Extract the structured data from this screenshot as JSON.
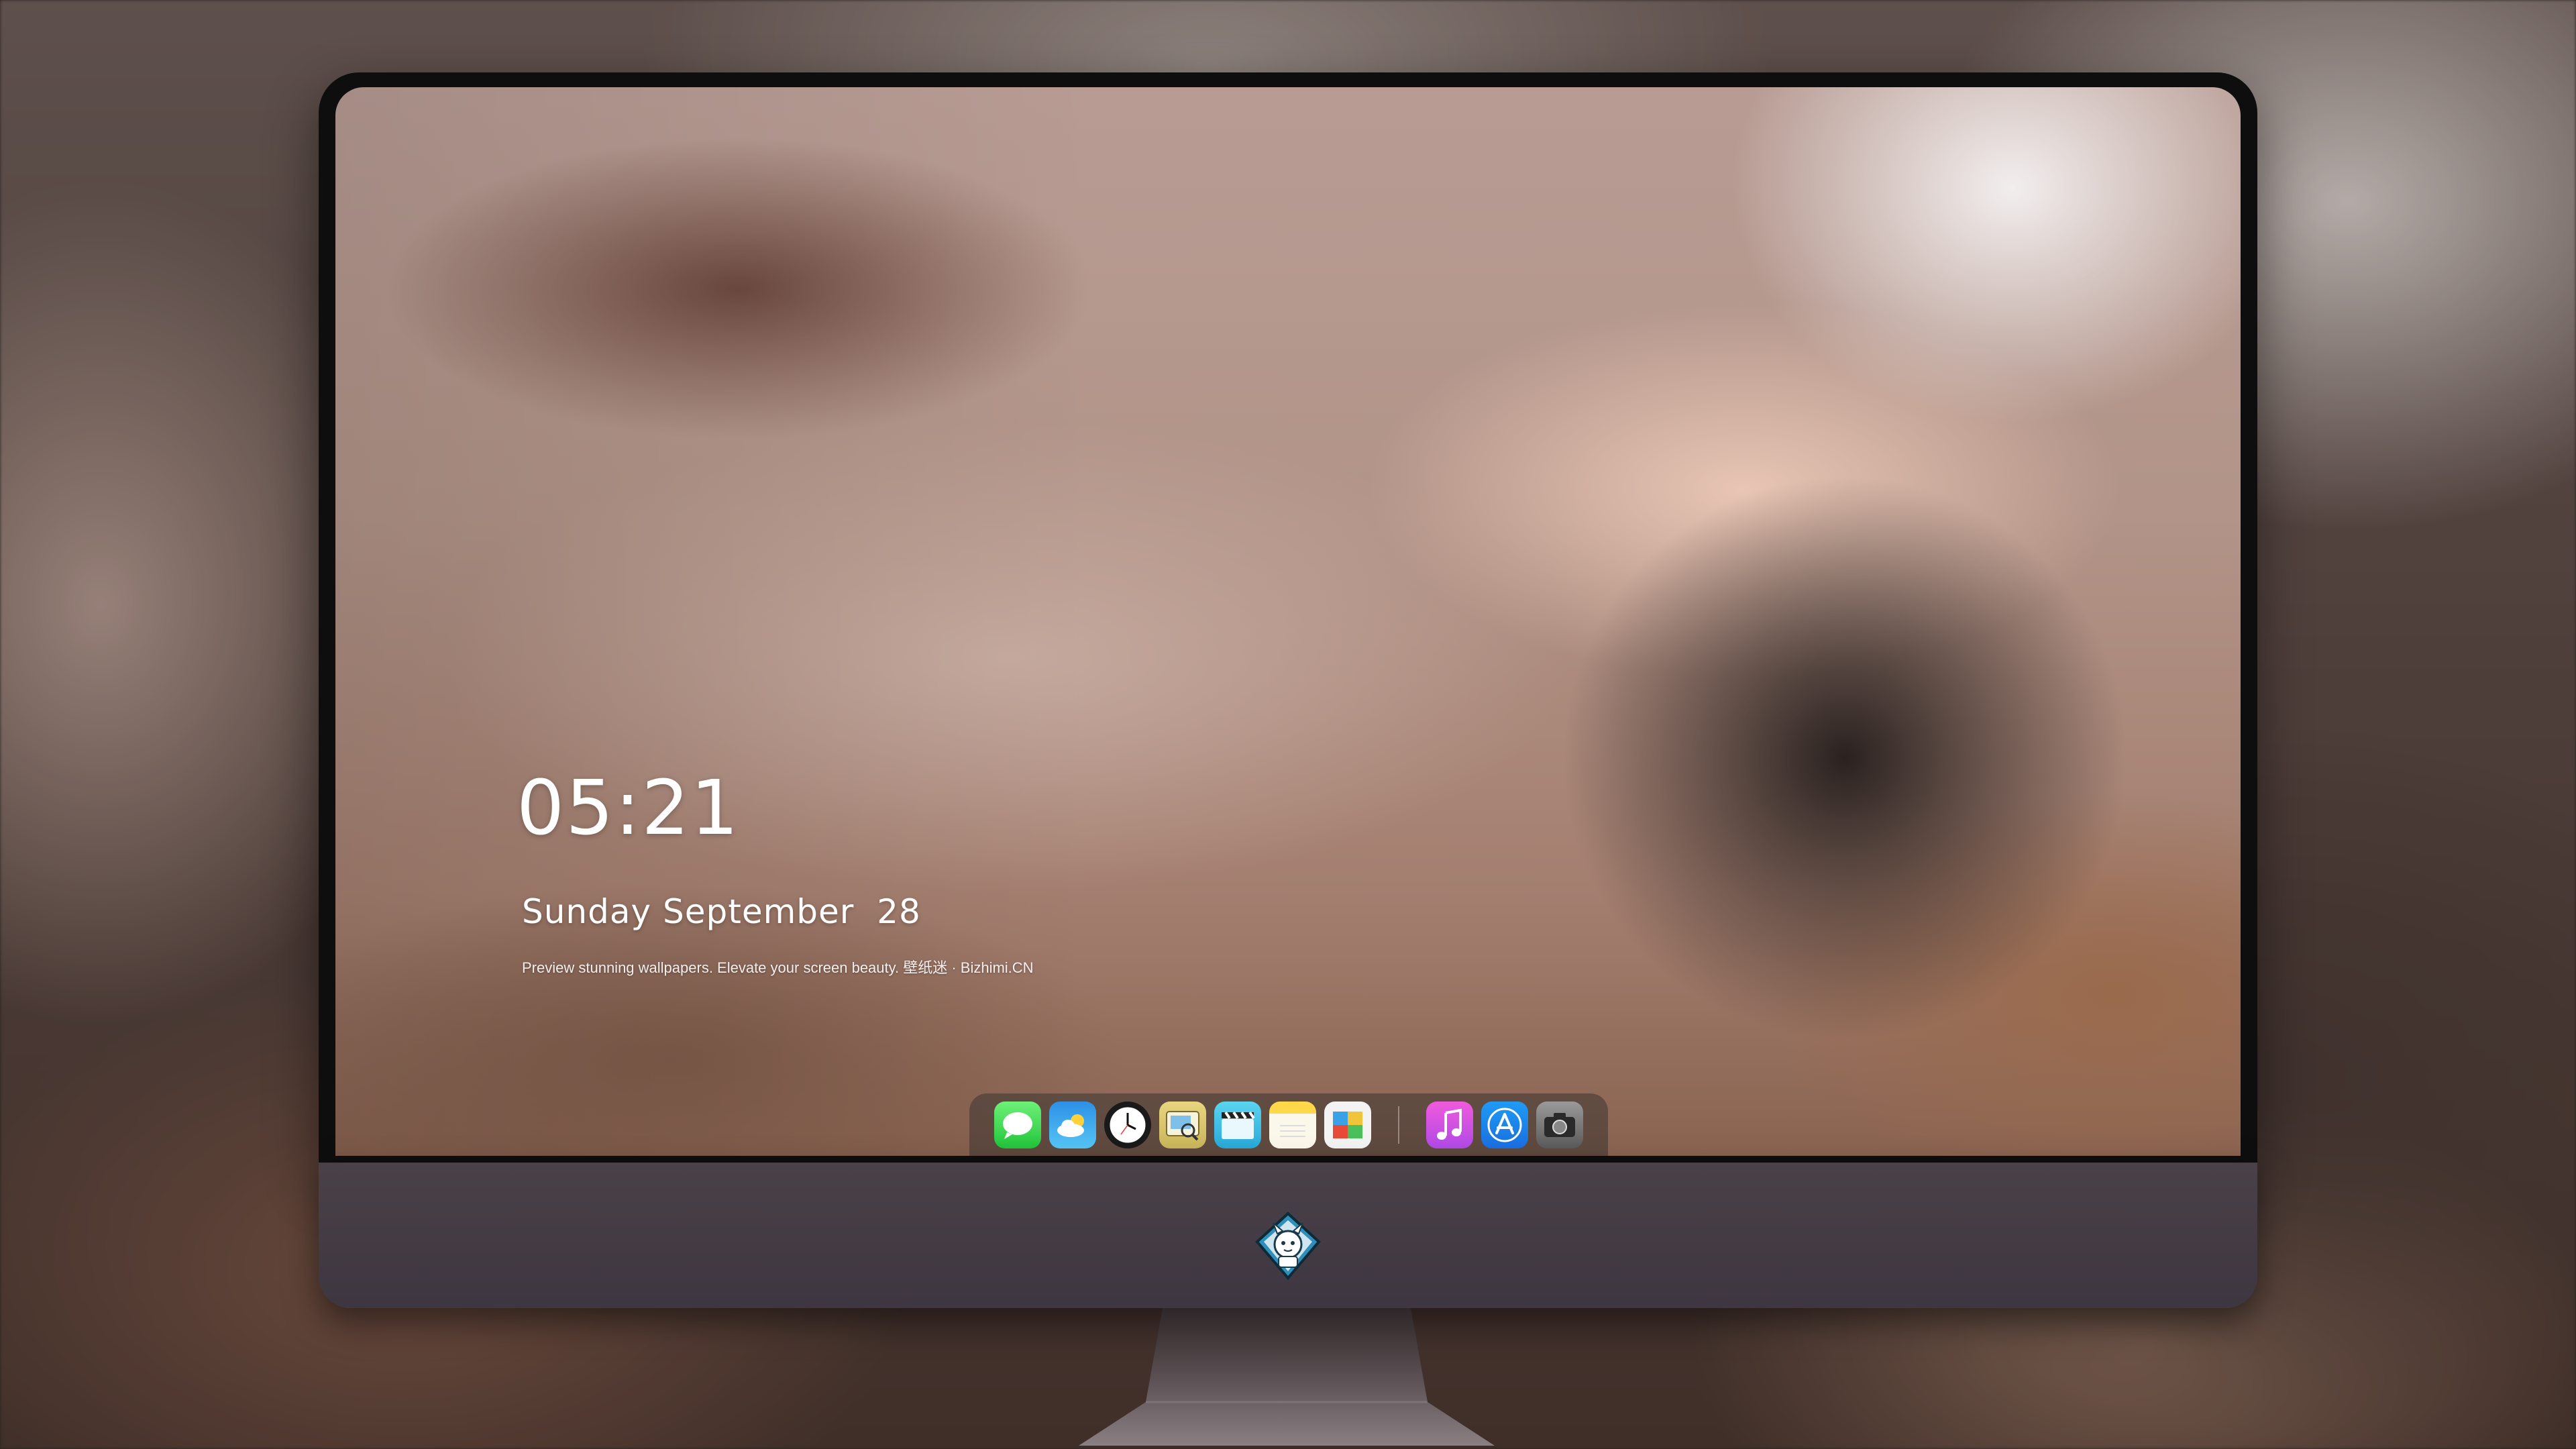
{
  "lock_screen": {
    "time": "05:21",
    "date": "Sunday September  28",
    "caption": "Preview stunning wallpapers. Elevate your screen beauty. 壁纸迷 · Bizhimi.CN"
  },
  "dock": {
    "apps": [
      {
        "name": "messages-icon"
      },
      {
        "name": "weather-icon"
      },
      {
        "name": "clock-icon"
      },
      {
        "name": "preview-icon"
      },
      {
        "name": "clapperboard-icon"
      },
      {
        "name": "notes-icon"
      },
      {
        "name": "photos-icon"
      },
      {
        "name": "music-icon"
      },
      {
        "name": "app-store-icon"
      },
      {
        "name": "camera-icon"
      }
    ]
  },
  "colors": {
    "bezel": "#0f0e0f",
    "chin": "#4a4148",
    "dock_background": "#3c3432",
    "text": "#ffffff"
  }
}
